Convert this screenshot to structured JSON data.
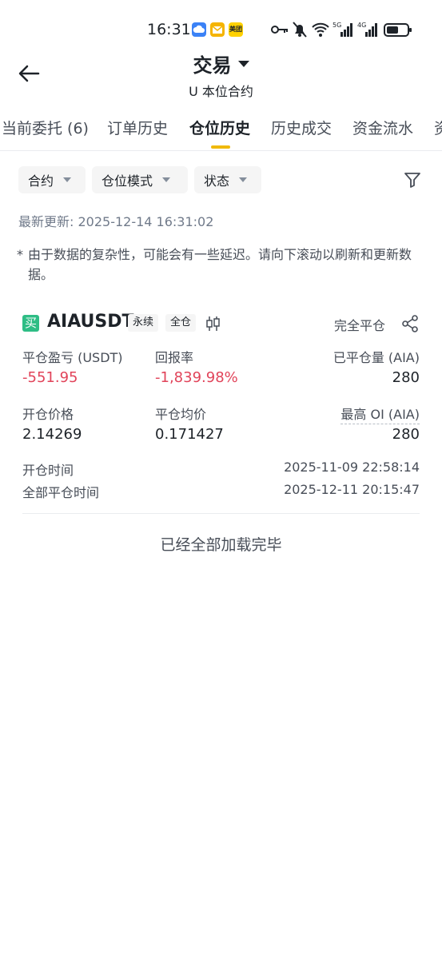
{
  "status_bar": {
    "time": "16:31",
    "apps": [
      {
        "icon": "cloud-app-icon",
        "color": "#3b82f6"
      },
      {
        "icon": "mail-app-icon",
        "color": "#f5b400"
      },
      {
        "icon": "meituan-app-icon",
        "color": "#ffd100",
        "label": "美团"
      }
    ],
    "icons": [
      "key-icon",
      "silent-bell-icon",
      "wifi-icon",
      "signal-5g-icon",
      "signal-4g-icon",
      "battery-icon"
    ]
  },
  "header": {
    "title": "交易",
    "subtitle": "U 本位合约"
  },
  "tabs": [
    {
      "label": "当前委托 (6)",
      "active": false
    },
    {
      "label": "订单历史",
      "active": false
    },
    {
      "label": "仓位历史",
      "active": true
    },
    {
      "label": "历史成交",
      "active": false
    },
    {
      "label": "资金流水",
      "active": false
    },
    {
      "label": "资",
      "active": false
    }
  ],
  "filters": [
    {
      "label": "合约"
    },
    {
      "label": "仓位模式"
    },
    {
      "label": "状态"
    }
  ],
  "last_updated": "最新更新: 2025-12-14 16:31:02",
  "note": {
    "star": "*",
    "text": "由于数据的复杂性，可能会有一些延迟。请向下滚动以刷新和更新数据。"
  },
  "position": {
    "side_badge": "买",
    "symbol": "AIAUSDT",
    "tags": [
      "永续",
      "全仓"
    ],
    "status": "完全平仓",
    "pnl_label": "平仓盈亏 (USDT)",
    "pnl_value": "-551.95",
    "roi_label": "回报率",
    "roi_value": "-1,839.98%",
    "closed_qty_label": "已平仓量 (AIA)",
    "closed_qty_value": "280",
    "open_price_label": "开仓价格",
    "open_price_value": "2.14269",
    "avg_close_label": "平仓均价",
    "avg_close_value": "0.171427",
    "max_oi_label": "最高 OI (AIA)",
    "max_oi_value": "280",
    "open_time_label": "开仓时间",
    "open_time_value": "2025-11-09 22:58:14",
    "close_time_label": "全部平仓时间",
    "close_time_value": "2025-12-11 20:15:47"
  },
  "end_message": "已经全部加载完毕",
  "colors": {
    "accent": "#f0b90b",
    "buy": "#2ebd85",
    "negative": "#e1445a"
  }
}
